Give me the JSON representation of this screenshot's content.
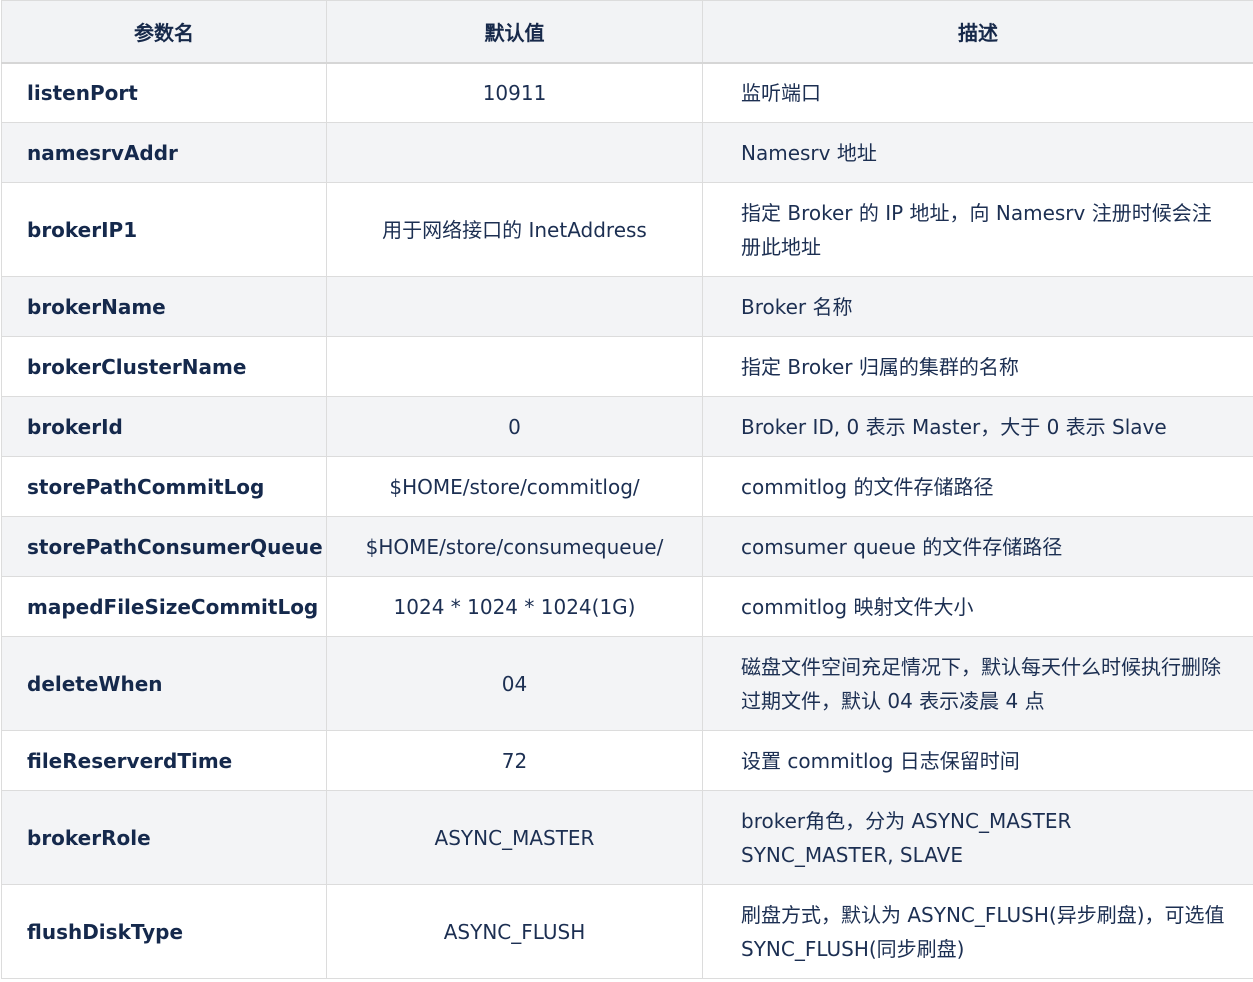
{
  "headers": {
    "name": "参数名",
    "default": "默认值",
    "description": "描述"
  },
  "rows": [
    {
      "name": "listenPort",
      "default": "10911",
      "description": "监听端口"
    },
    {
      "name": "namesrvAddr",
      "default": "",
      "description": "Namesrv 地址"
    },
    {
      "name": "brokerIP1",
      "default": "用于网络接口的 InetAddress",
      "description": "指定 Broker 的 IP 地址，向 Namesrv 注册时候会注册此地址"
    },
    {
      "name": "brokerName",
      "default": "",
      "description": "Broker 名称"
    },
    {
      "name": "brokerClusterName",
      "default": "",
      "description": "指定 Broker 归属的集群的名称"
    },
    {
      "name": "brokerId",
      "default": "0",
      "description": "Broker ID, 0 表示 Master，大于 0 表示 Slave"
    },
    {
      "name": "storePathCommitLog",
      "default": "$HOME/store/commitlog/",
      "description": "commitlog 的文件存储路径"
    },
    {
      "name": "storePathConsumerQueue",
      "default": "$HOME/store/consumequeue/",
      "description": "comsumer queue 的文件存储路径"
    },
    {
      "name": "mapedFileSizeCommitLog",
      "default": "1024 * 1024 * 1024(1G)",
      "description": "commitlog 映射文件大小"
    },
    {
      "name": "deleteWhen",
      "default": "04",
      "description": "磁盘文件空间充足情况下，默认每天什么时候执行删除过期文件，默认 04 表示凌晨 4 点"
    },
    {
      "name": "fileReserverdTime",
      "default": "72",
      "description": "设置 commitlog 日志保留时间"
    },
    {
      "name": "brokerRole",
      "default": "ASYNC_MASTER",
      "description": "broker角色，分为 ASYNC_MASTER SYNC_MASTER, SLAVE"
    },
    {
      "name": "flushDiskType",
      "default": "ASYNC_FLUSH",
      "description": "刷盘方式，默认为 ASYNC_FLUSH(异步刷盘)，可选值SYNC_FLUSH(同步刷盘)"
    }
  ]
}
